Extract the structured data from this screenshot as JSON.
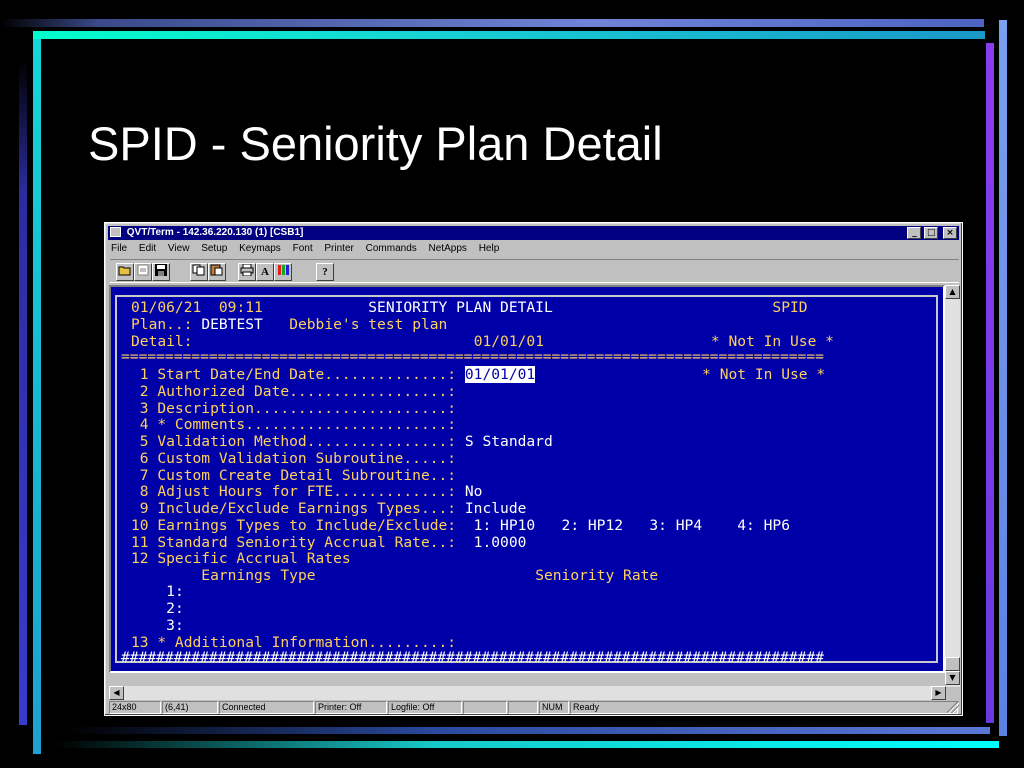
{
  "slide": {
    "title": "SPID - Seniority Plan Detail"
  },
  "window": {
    "title": "QVT/Term - 142.36.220.130 (1) [CSB1]",
    "menu": [
      "File",
      "Edit",
      "View",
      "Setup",
      "Keymaps",
      "Font",
      "Printer",
      "Commands",
      "NetApps",
      "Help"
    ],
    "toolbar": {
      "open_icon": "open-folder-icon",
      "print_screen_icon": "print-icon",
      "save_icon": "floppy-disk-icon",
      "copy_icon": "copy-icon",
      "paste_icon": "paste-icon",
      "printer_icon": "printer-icon",
      "font_label": "A",
      "colors_icon": "color-bars-icon",
      "help_label": "?"
    },
    "controls": {
      "minimize": "_",
      "maximize": "□",
      "close": "×"
    }
  },
  "terminal": {
    "header_date": "01/06/21",
    "header_time": "09:11",
    "header_title": "SENIORITY PLAN DETAIL",
    "header_code": "SPID",
    "plan_label": "Plan..:",
    "plan_value": "DEBTEST",
    "plan_desc": "Debbie's test plan",
    "detail_label": "Detail:",
    "detail_date": "01/01/01",
    "detail_status": "* Not In Use *",
    "rule": "================================================================================",
    "fields": [
      {
        "label": " 1 Start Date/End Date..............:",
        "value": "01/01/01",
        "extra": "* Not In Use *"
      },
      {
        "label": " 2 Authorized Date..................:",
        "value": ""
      },
      {
        "label": " 3 Description......................:",
        "value": ""
      },
      {
        "label": " 4 * Comments.......................:",
        "value": ""
      },
      {
        "label": " 5 Validation Method................:",
        "value": "S Standard"
      },
      {
        "label": " 6 Custom Validation Subroutine.....:",
        "value": ""
      },
      {
        "label": " 7 Custom Create Detail Subroutine..:",
        "value": ""
      },
      {
        "label": " 8 Adjust Hours for FTE.............:",
        "value": "No"
      },
      {
        "label": " 9 Include/Exclude Earnings Types...:",
        "value": "Include"
      },
      {
        "label": "10 Earnings Types to Include/Exclude:",
        "value": " 1: HP10   2: HP12   3: HP4    4: HP6"
      },
      {
        "label": "11 Standard Seniority Accrual Rate..:",
        "value": " 1.0000"
      },
      {
        "label": "12 Specific Accrual Rates",
        "value": ""
      }
    ],
    "accrual_headers": {
      "earnings_type": "Earnings Type",
      "seniority_rate": "Seniority Rate"
    },
    "accrual_rows": [
      "1:",
      "2:",
      "3:"
    ],
    "field_13": "13 * Additional Information.........:",
    "fill_row": "################################################################################"
  },
  "status": {
    "size": "24x80",
    "cursor": "(6,41)",
    "connection": "Connected",
    "printer": "Printer: Off",
    "logfile": "Logfile: Off",
    "num": "NUM",
    "ready": "Ready"
  },
  "colors": {
    "terminal_bg": "#0000a8",
    "terminal_text": "#ffd060",
    "titlebar": "#000080"
  }
}
